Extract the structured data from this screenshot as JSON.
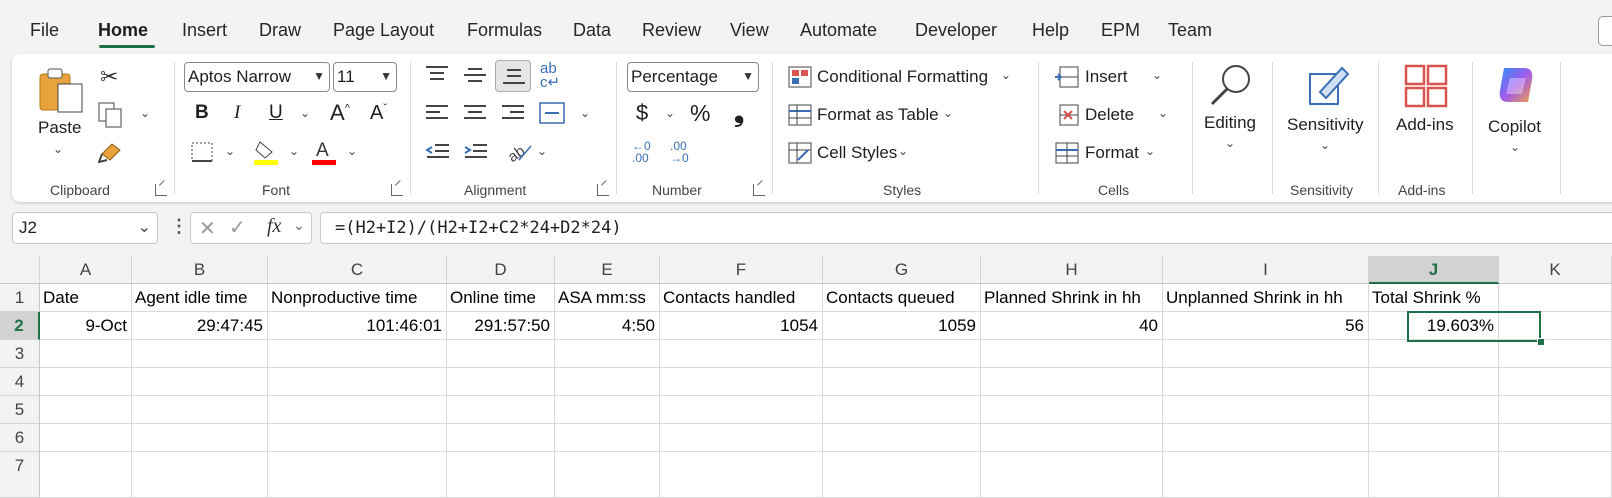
{
  "menu": [
    "File",
    "Home",
    "Insert",
    "Draw",
    "Page Layout",
    "Formulas",
    "Data",
    "Review",
    "View",
    "Automate",
    "Developer",
    "Help",
    "EPM",
    "Team"
  ],
  "ribbon": {
    "clipboard": {
      "label": "Clipboard",
      "paste": "Paste"
    },
    "font": {
      "label": "Font",
      "font_name": "Aptos Narrow",
      "font_size": "11"
    },
    "alignment": {
      "label": "Alignment"
    },
    "number": {
      "label": "Number",
      "format": "Percentage"
    },
    "styles": {
      "label": "Styles",
      "conditional": "Conditional Formatting",
      "format_table": "Format as Table",
      "cell_styles": "Cell Styles"
    },
    "cells": {
      "label": "Cells",
      "insert": "Insert",
      "delete": "Delete",
      "format": "Format"
    },
    "editing": {
      "label": "Editing"
    },
    "sensitivity": {
      "label": "Sensitivity",
      "button": "Sensitivity"
    },
    "addins": {
      "label": "Add-ins",
      "button": "Add-ins"
    },
    "copilot": {
      "button": "Copilot"
    }
  },
  "formula_bar": {
    "name_box": "J2",
    "formula": "=(H2+I2)/(H2+I2+C2*24+D2*24)"
  },
  "sheet": {
    "columns": [
      "A",
      "B",
      "C",
      "D",
      "E",
      "F",
      "G",
      "H",
      "I",
      "J",
      "K"
    ],
    "rows": [
      "1",
      "2",
      "3",
      "4",
      "5",
      "6",
      "7"
    ],
    "headers": [
      "Date",
      "Agent idle time",
      "Nonproductive time",
      "Online time",
      "ASA mm:ss",
      "Contacts handled",
      "Contacts queued",
      "Planned Shrink in hh",
      "Unplanned Shrink in hh",
      "Total Shrink %"
    ],
    "data_row": [
      "9-Oct",
      "29:47:45",
      "101:46:01",
      "291:57:50",
      "4:50",
      "1054",
      "1059",
      "40",
      "56",
      "19.603%"
    ],
    "selected_cell": "J2"
  },
  "colors": {
    "accent": "#1e7145",
    "highlight_yellow": "#ffff00",
    "font_red": "#ff0000"
  }
}
